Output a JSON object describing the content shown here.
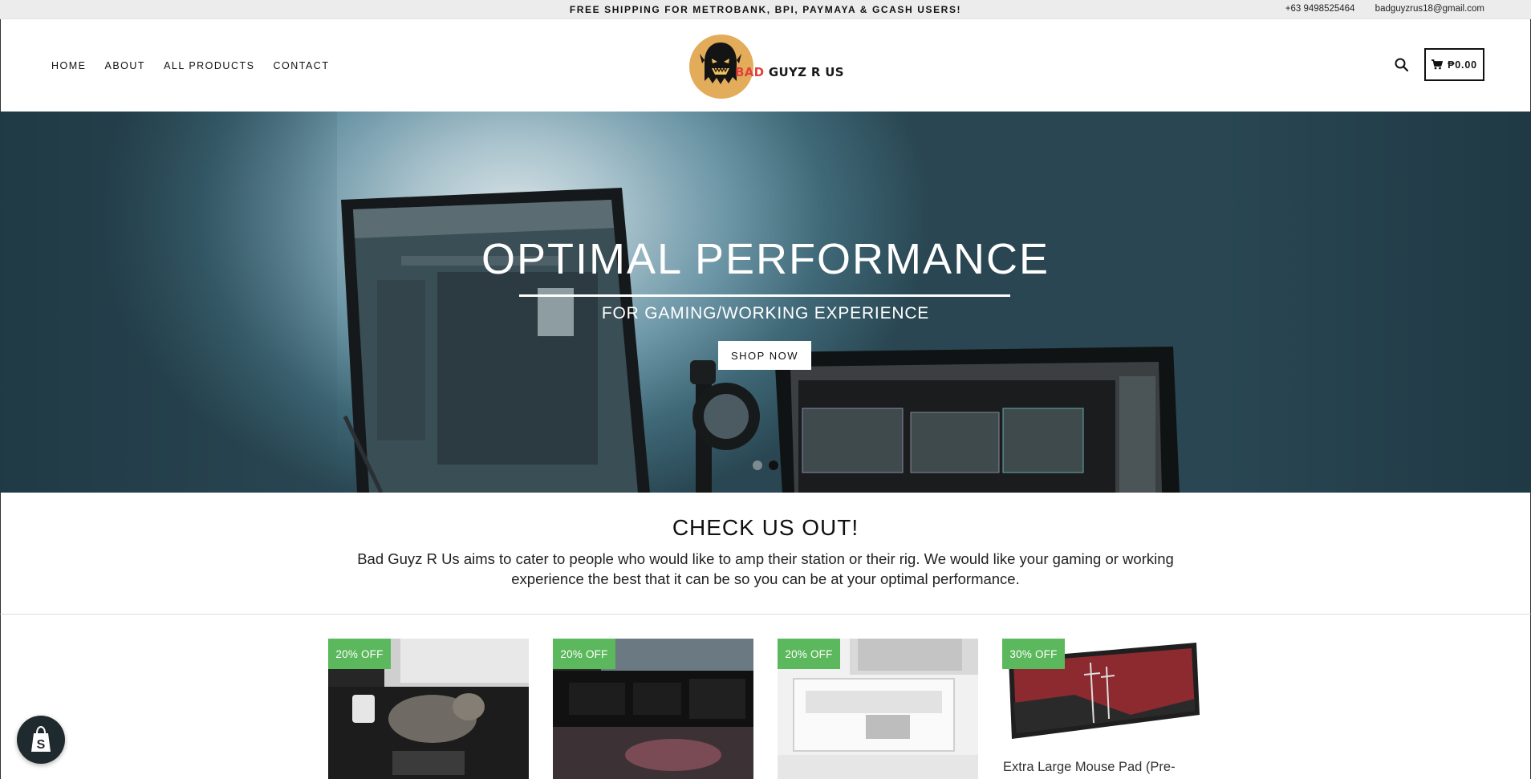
{
  "topbar": {
    "announcement": "FREE SHIPPING FOR METROBANK, BPI, PAYMAYA & GCASH USERS!",
    "phone": "+63 9498525464",
    "email": "badguyzrus18@gmail.com"
  },
  "nav": {
    "home": "HOME",
    "about": "ABOUT",
    "all_products": "ALL PRODUCTS",
    "contact": "CONTACT"
  },
  "logo": {
    "bad": "BAD",
    "rest": " GUYZ R US"
  },
  "cart": {
    "total": "₱0.00"
  },
  "hero": {
    "title": "OPTIMAL PERFORMANCE",
    "subtitle": "FOR GAMING/WORKING EXPERIENCE",
    "button": "SHOP NOW",
    "slides": 2,
    "active_slide": 2
  },
  "intro": {
    "heading": "CHECK US OUT!",
    "body": "Bad Guyz R Us aims to cater to people who would like to amp their station or their rig. We would like your gaming or working experience the best that it can be so you can be at your optimal performance."
  },
  "products": [
    {
      "badge": "20% OFF"
    },
    {
      "badge": "20% OFF"
    },
    {
      "badge": "20% OFF"
    },
    {
      "badge": "30% OFF",
      "title": "Extra Large Mouse Pad (Pre-"
    }
  ],
  "icons": {
    "search": "search-icon",
    "cart": "cart-icon",
    "shopify": "shopify-bag-icon",
    "logo": "ghost-logo-icon"
  },
  "colors": {
    "badge_green": "#5cb85c",
    "logo_orange": "#e3ac5a",
    "logo_red": "#e0423c"
  }
}
